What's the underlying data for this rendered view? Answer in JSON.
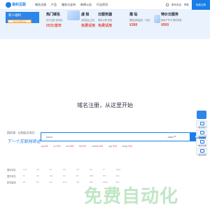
{
  "logo": {
    "text": "易科互联"
  },
  "nav": {
    "items": [
      "域名注册",
      "产品",
      "服务与支持",
      "新闻公告",
      "行业资讯"
    ]
  },
  "topright": {
    "phone_label": "联系电话",
    "help": "帮助",
    "login": "免费注册"
  },
  "banner": {
    "new_user": {
      "title": "新人福利",
      "button": "新户优惠专享"
    },
    "promos": [
      {
        "name": "热门域名",
        "desc": "年付注册 首年起",
        "price": "55元/首年"
      },
      {
        "name": "虚 拟",
        "desc": "高性能云主机",
        "price": "免费试用"
      },
      {
        "name": "云服务器",
        "desc": "弹性计算 按需",
        "price": "免费试用"
      },
      {
        "name": "建 站",
        "desc": "模板自助建站 一站式",
        "price": "¥388"
      },
      {
        "name": "特价云服务",
        "desc": "新用户专享 限时特惠",
        "price": "¥999"
      }
    ]
  },
  "hero": {
    "title": "域名注册，从这里开始"
  },
  "slogan": {
    "a": "国际域 · 以购起点成功",
    "b": "下一个互联网奇迹"
  },
  "search": {
    "placeholder": "baca",
    "suffix": ".com"
  },
  "prices": [
    {
      "ext": ".top",
      "price": "¥9"
    },
    {
      "ext": ".cc",
      "price": "¥75"
    },
    {
      "ext": ".xin",
      "price": "¥45"
    },
    {
      "ext": ".ltd",
      "price": "¥27"
    },
    {
      "ext": ".online",
      "price": "¥32"
    },
    {
      "ext": ".xyz",
      "price": "¥15"
    },
    {
      "ext": ".shop",
      "price": "¥16"
    }
  ],
  "side_tools": [
    {
      "label": "联系我们"
    },
    {
      "label": "在线客服"
    },
    {
      "label": "电话咨询"
    },
    {
      "label": "返回顶部"
    }
  ],
  "domains": {
    "rows": [
      {
        "label": "国际域名",
        "cells": [
          ".com",
          ".net",
          ".cn",
          ".top",
          ".xyz",
          ".vip",
          ".cc",
          ".shop"
        ]
      },
      {
        "label": "国内域名",
        "cells": [
          ".cn",
          ".net",
          ".org",
          ".xin",
          ".ltd",
          ".club",
          ".info",
          ".site"
        ]
      },
      {
        "label": "新顶级域",
        "cells": [
          ".art",
          ".ink",
          ".fun",
          ".tech",
          ".red",
          ".pub",
          ".wang",
          ".link"
        ]
      }
    ]
  },
  "watermark": {
    "text": "免费自动化"
  },
  "colors": {
    "accent": "#1a7ee6",
    "price": "#e84c3d",
    "banner_bg": "#eaf3fd"
  }
}
